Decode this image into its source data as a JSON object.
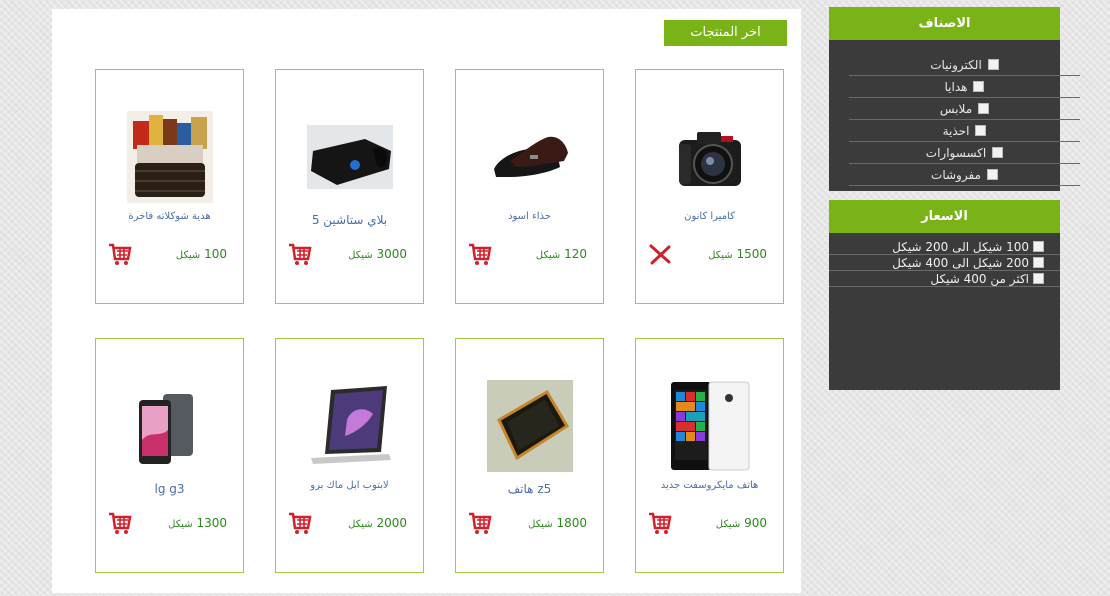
{
  "latest": {
    "title": "اخر المنتجات"
  },
  "products": [
    {
      "name": "كاميرا كانون",
      "price": "1500",
      "currency": "شيكل",
      "action": "remove",
      "image": "camera"
    },
    {
      "name": "حذاء اسود",
      "price": "120",
      "currency": "شيكل",
      "action": "cart",
      "image": "shoes"
    },
    {
      "name": "بلاي ستاشين 5",
      "price": "3000",
      "currency": "شيكل",
      "action": "cart",
      "image": "console"
    },
    {
      "name": "هدية شوكلاته فاخرة",
      "price": "100",
      "currency": "شيكل",
      "action": "cart",
      "image": "basket"
    },
    {
      "name": "هاتف مايكروسفت جديد",
      "price": "900",
      "currency": "شيكل",
      "action": "cart",
      "image": "lumia"
    },
    {
      "name": "z5 هاتف",
      "price": "1800",
      "currency": "شيكل",
      "action": "cart",
      "image": "z5"
    },
    {
      "name": "لابتوب ابل ماك برو",
      "price": "2000",
      "currency": "شيكل",
      "action": "cart",
      "image": "macbook"
    },
    {
      "name": "lg g3",
      "price": "1300",
      "currency": "شيكل",
      "action": "cart",
      "image": "lg"
    }
  ],
  "categories": {
    "title": "الاصناف",
    "items": [
      "الكترونيات",
      "هدايا",
      "ملابس",
      "احذية",
      "اكسسوارات",
      "مفروشات"
    ]
  },
  "prices": {
    "title": "الاسعار",
    "items": [
      "100 شيكل الى 200 شيكل",
      "200 شيكل الى 400 شيكل",
      "اكثر من 400 شيكل"
    ]
  },
  "colors": {
    "accent": "#7ab317",
    "panel": "#3b3b3b",
    "price": "#2d8a1c",
    "cart": "#d4202b"
  }
}
